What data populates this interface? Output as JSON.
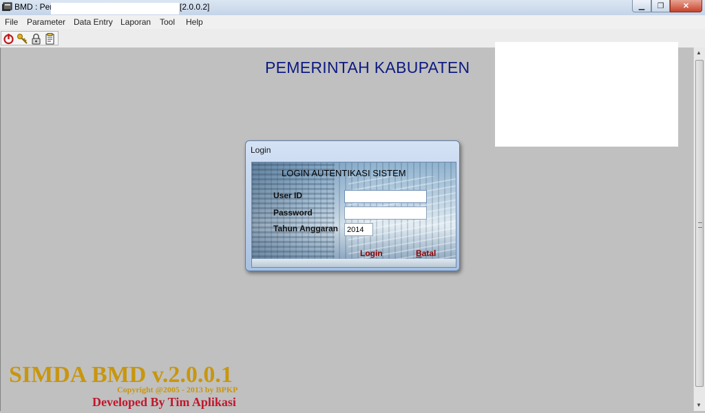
{
  "window": {
    "title_prefix": "BMD : Per",
    "title_version": "[2.0.0.2]",
    "min_glyph": "▁",
    "max_glyph": "❐",
    "close_glyph": "✕"
  },
  "menu": [
    "File",
    "Parameter",
    "Data Entry",
    "Laporan",
    "Tool",
    "Help"
  ],
  "toolbar": {
    "icons": [
      "power-icon",
      "key-icon",
      "lock-icon",
      "notepad-icon"
    ]
  },
  "main": {
    "heading": "PEMERINTAH KABUPATEN"
  },
  "login_dialog": {
    "title": "Login",
    "heading": "LOGIN AUTENTIKASI SISTEM",
    "user_id_label": "User ID",
    "user_id_value": "",
    "password_label": "Password",
    "password_value": "",
    "tahun_label": "Tahun Anggaran",
    "tahun_value": "2014",
    "login_button": "Login",
    "batal_prefix": "B",
    "batal_rest": "atal"
  },
  "footer": {
    "brand": "SIMDA BMD v.2.0.0.1",
    "copyright": "Copyright @2005 - 2013 by BPKP",
    "developed": "Developed By Tim Aplikasi"
  },
  "colors": {
    "heading": "#0d1a80",
    "brand": "#c8960f",
    "developed": "#c0172c",
    "dialog_button": "#8b0000"
  }
}
